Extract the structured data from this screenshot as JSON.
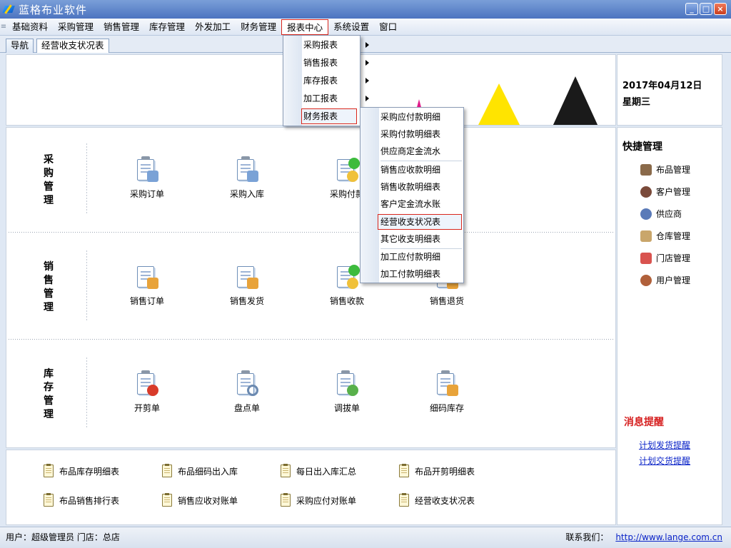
{
  "window": {
    "title": "蓝格布业软件",
    "buttons": [
      "_",
      "□",
      "×"
    ]
  },
  "menu": [
    "基础资料",
    "采购管理",
    "销售管理",
    "库存管理",
    "外发加工",
    "财务管理",
    "报表中心",
    "系统设置",
    "窗口"
  ],
  "tabs": [
    "导航",
    "经营收支状况表"
  ],
  "date": {
    "date": "2017年04月12日",
    "weekday": "星期三"
  },
  "sections": [
    {
      "title": [
        "采",
        "购",
        "管",
        "理"
      ],
      "tools": [
        "采购订单",
        "采购入库",
        "采购付款"
      ]
    },
    {
      "title": [
        "销",
        "售",
        "管",
        "理"
      ],
      "tools": [
        "销售订单",
        "销售发货",
        "销售收款",
        "销售退货"
      ]
    },
    {
      "title": [
        "库",
        "存",
        "管",
        "理"
      ],
      "tools": [
        "开剪单",
        "盘点单",
        "调拔单",
        "细码库存"
      ]
    }
  ],
  "quick_links": [
    [
      "布品库存明细表",
      "布品细码出入库",
      "每日出入库汇总",
      "布品开剪明细表"
    ],
    [
      "布品销售排行表",
      "销售应收对账单",
      "采购应付对账单",
      "经营收支状况表"
    ]
  ],
  "shortcut": {
    "title": "快捷管理",
    "items": [
      "布品管理",
      "客户管理",
      "供应商",
      "仓库管理",
      "门店管理",
      "用户管理"
    ]
  },
  "messages": {
    "title": "消息提醒",
    "links": [
      "计划发货提醒",
      "计划交货提醒"
    ]
  },
  "status": {
    "left": "用户：超级管理员  门店：总店",
    "contact": "联系我们：",
    "url": "http://www.lange.com.cn"
  },
  "report_menu": [
    "采购报表",
    "销售报表",
    "库存报表",
    "加工报表",
    "财务报表"
  ],
  "finance_menu": [
    "采购应付款明细",
    "采购付款明细表",
    "供应商定金流水",
    "销售应收款明细",
    "销售收款明细表",
    "客户定金流水账",
    "经营收支状况表",
    "其它收支明细表",
    "加工应付款明细",
    "加工付款明细表"
  ],
  "colors": {
    "titlebar": "#4d74c0",
    "highlight_border": "#d9261c",
    "link": "#0b24c8",
    "alert": "#d62020"
  }
}
